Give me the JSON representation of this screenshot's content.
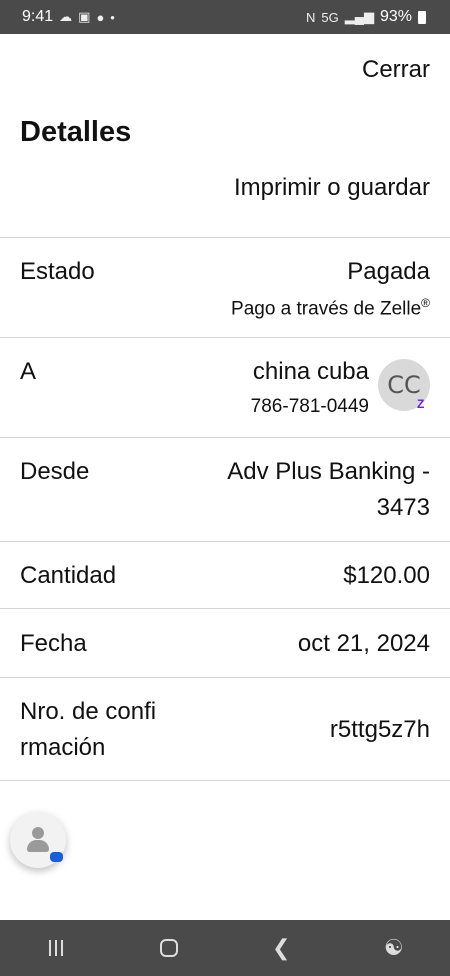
{
  "status_bar": {
    "time": "9:41",
    "left_icons": [
      "cloud-icon",
      "image-icon",
      "chat-icon",
      "dot-icon"
    ],
    "network": "5G",
    "battery": "93%"
  },
  "header": {
    "close_label": "Cerrar",
    "title": "Detalles",
    "print_label": "Imprimir o guardar"
  },
  "rows": {
    "estado": {
      "label": "Estado",
      "value": "Pagada",
      "sub": "Pago a través de Zelle",
      "sub_mark": "®"
    },
    "a": {
      "label": "A",
      "value": "china cuba",
      "sub": "786-781-0449",
      "avatar_initials": "CC",
      "badge": "Z"
    },
    "desde": {
      "label": "Desde",
      "value_line1": "Adv Plus Banking -",
      "value_line2": "3473"
    },
    "cantidad": {
      "label": "Cantidad",
      "value": "$120.00"
    },
    "fecha": {
      "label": "Fecha",
      "value": "oct 21, 2024"
    },
    "confirmacion": {
      "label_line1": "Nro. de confi",
      "label_line2": "rmación",
      "value": "r5ttg5z7h"
    }
  },
  "colors": {
    "status_bar_bg": "#4a4a4a",
    "zelle_purple": "#6d1ed4",
    "chat_blue": "#1a5fd6"
  },
  "nav_bar": {
    "buttons": [
      "recents-icon",
      "home-icon",
      "back-icon",
      "accessibility-icon"
    ]
  }
}
